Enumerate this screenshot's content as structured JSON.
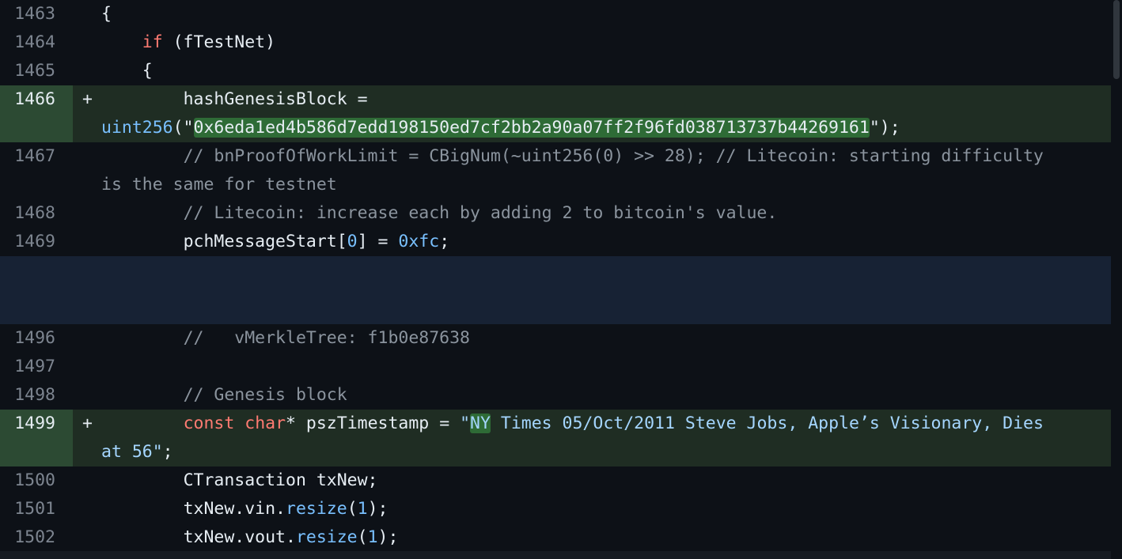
{
  "lines": {
    "l1463": {
      "num": "1463",
      "text": "{"
    },
    "l1464": {
      "num": "1464",
      "kw": "if",
      "text": " (fTestNet)"
    },
    "l1465": {
      "num": "1465",
      "text": "{"
    },
    "l1466": {
      "num": "1466",
      "sign": "+",
      "text1": "hashGenesisBlock =",
      "fn": "uint256",
      "open": "(\"",
      "hash": "0x6eda1ed4b586d7edd198150ed7cf2bb2a90a07ff2f96fd038713737b44269161",
      "close": "\");"
    },
    "l1467": {
      "num": "1467",
      "comment": "// bnProofOfWorkLimit = CBigNum(~uint256(0) >> 28); // Litecoin: starting difficulty is the same for testnet"
    },
    "l1468": {
      "num": "1468",
      "comment": "// Litecoin: increase each by adding 2 to bitcoin's value."
    },
    "l1469": {
      "num": "1469",
      "pre": "pchMessageStart[",
      "idx": "0",
      "mid": "] = ",
      "val": "0xfc",
      "end": ";"
    },
    "l1496": {
      "num": "1496",
      "comment": "//   vMerkleTree: f1b0e87638"
    },
    "l1497": {
      "num": "1497"
    },
    "l1498": {
      "num": "1498",
      "comment": "// Genesis block"
    },
    "l1499": {
      "num": "1499",
      "sign": "+",
      "kw1": "const",
      "kw2": "char",
      "rest": "* pszTimestamp = ",
      "q": "\"",
      "ny": "NY",
      "str": " Times 05/Oct/2011 Steve Jobs, Apple’s Visionary, Dies at 56\"",
      "end": ";"
    },
    "l1500": {
      "num": "1500",
      "text": "CTransaction txNew;"
    },
    "l1501": {
      "num": "1501",
      "pre": "txNew.vin.",
      "call": "resize",
      "open": "(",
      "arg": "1",
      "close": ");"
    },
    "l1502": {
      "num": "1502",
      "pre": "txNew.vout.",
      "call": "resize",
      "open": "(",
      "arg": "1",
      "close": ");"
    }
  },
  "colors": {
    "background": "#0d1117",
    "added_row": "#1f2d23",
    "added_gutter": "#2c4a33",
    "expander": "#172234",
    "keyword": "#ff7b72",
    "function": "#d2a8ff",
    "number": "#79c0ff",
    "string": "#a5d6ff",
    "comment": "#8b949e"
  }
}
